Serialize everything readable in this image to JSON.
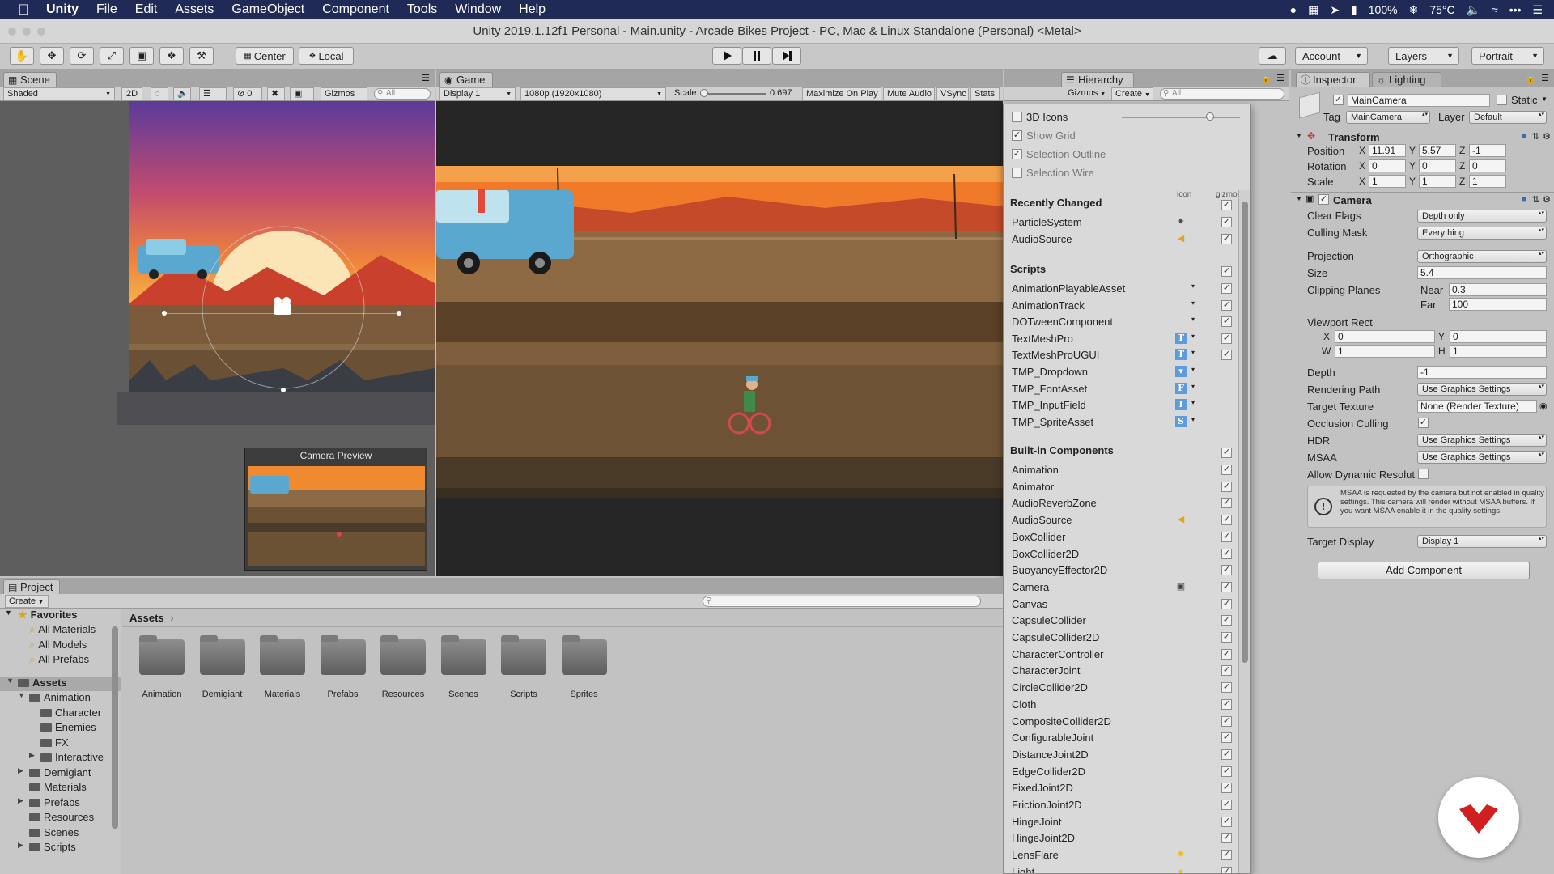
{
  "menubar": {
    "items": [
      "Unity",
      "File",
      "Edit",
      "Assets",
      "GameObject",
      "Component",
      "Tools",
      "Window",
      "Help"
    ],
    "battery": "100%",
    "temperature": "75°C"
  },
  "window": {
    "title": "Unity 2019.1.12f1 Personal - Main.unity - Arcade Bikes Project - PC, Mac & Linux Standalone (Personal) <Metal>"
  },
  "toolbar": {
    "pivot": "Center",
    "space": "Local",
    "account": "Account",
    "layers": "Layers",
    "layout": "Portrait"
  },
  "scene": {
    "tab": "Scene",
    "shading": "Shaded",
    "mode2d": "2D",
    "fx_count": "0",
    "gizmos": "Gizmos",
    "search_placeholder": "All",
    "camera_preview": "Camera Preview"
  },
  "game": {
    "tab": "Game",
    "display": "Display 1",
    "resolution": "1080p (1920x1080)",
    "scale_label": "Scale",
    "scale_value": "0.697",
    "maximize": "Maximize On Play",
    "mute": "Mute Audio",
    "vsync": "VSync",
    "stats": "Stats",
    "gizmos": "Gizmos"
  },
  "hierarchy": {
    "tab": "Hierarchy",
    "create": "Create",
    "search_placeholder": "All"
  },
  "gizmo_menu": {
    "options": [
      "3D Icons",
      "Show Grid",
      "Selection Outline",
      "Selection Wire"
    ],
    "col_icon": "icon",
    "col_gizmo": "gizmo",
    "recent_header": "Recently Changed",
    "recent": [
      "ParticleSystem",
      "AudioSource"
    ],
    "scripts_header": "Scripts",
    "scripts": [
      "AnimationPlayableAsset",
      "AnimationTrack",
      "DOTweenComponent",
      "TextMeshPro",
      "TextMeshProUGUI",
      "TMP_Dropdown",
      "TMP_FontAsset",
      "TMP_InputField",
      "TMP_SpriteAsset"
    ],
    "script_icons": [
      "",
      "",
      "",
      "T",
      "T",
      "▾",
      "F",
      "I",
      "S"
    ],
    "builtin_header": "Built-in Components",
    "builtin": [
      "Animation",
      "Animator",
      "AudioReverbZone",
      "AudioSource",
      "BoxCollider",
      "BoxCollider2D",
      "BuoyancyEffector2D",
      "Camera",
      "Canvas",
      "CapsuleCollider",
      "CapsuleCollider2D",
      "CharacterController",
      "CharacterJoint",
      "CircleCollider2D",
      "Cloth",
      "CompositeCollider2D",
      "ConfigurableJoint",
      "DistanceJoint2D",
      "EdgeCollider2D",
      "FixedJoint2D",
      "FrictionJoint2D",
      "HingeJoint",
      "HingeJoint2D",
      "LensFlare",
      "Light"
    ]
  },
  "inspector": {
    "tab": "Inspector",
    "tab2": "Lighting",
    "object_name": "MainCamera",
    "static_label": "Static",
    "tag_label": "Tag",
    "tag": "MainCamera",
    "layer_label": "Layer",
    "layer": "Default",
    "transform": {
      "header": "Transform",
      "position_label": "Position",
      "rotation_label": "Rotation",
      "scale_label": "Scale",
      "position": [
        "11.91",
        "5.57",
        "-1"
      ],
      "rotation": [
        "0",
        "0",
        "0"
      ],
      "scale": [
        "1",
        "1",
        "1"
      ]
    },
    "camera": {
      "header": "Camera",
      "clear_flags_label": "Clear Flags",
      "clear_flags": "Depth only",
      "culling_mask_label": "Culling Mask",
      "culling_mask": "Everything",
      "projection_label": "Projection",
      "projection": "Orthographic",
      "size_label": "Size",
      "size": "5.4",
      "clipping_label": "Clipping Planes",
      "near_label": "Near",
      "near": "0.3",
      "far_label": "Far",
      "far": "100",
      "viewport_label": "Viewport Rect",
      "vx": "0",
      "vy": "0",
      "vw": "1",
      "vh": "1",
      "depth_label": "Depth",
      "depth": "-1",
      "rendering_label": "Rendering Path",
      "rendering": "Use Graphics Settings",
      "target_texture_label": "Target Texture",
      "target_texture": "None (Render Texture)",
      "occlusion_label": "Occlusion Culling",
      "hdr_label": "HDR",
      "hdr": "Use Graphics Settings",
      "msaa_label": "MSAA",
      "msaa": "Use Graphics Settings",
      "dynres_label": "Allow Dynamic Resolut",
      "warning": "MSAA is requested by the camera but not enabled in quality settings. This camera will render without MSAA buffers. If you want MSAA enable it in the quality settings.",
      "target_display_label": "Target Display",
      "target_display": "Display 1"
    },
    "add_component": "Add Component"
  },
  "project": {
    "tab": "Project",
    "create": "Create",
    "favorites": "Favorites",
    "favorite_items": [
      "All Materials",
      "All Models",
      "All Prefabs"
    ],
    "assets_root": "Assets",
    "tree": [
      "Animation",
      "Character",
      "Enemies",
      "FX",
      "Interactive",
      "Demigiant",
      "Materials",
      "Prefabs",
      "Resources",
      "Scenes",
      "Scripts"
    ],
    "breadcrumb": "Assets",
    "folders": [
      "Animation",
      "Demigiant",
      "Materials",
      "Prefabs",
      "Resources",
      "Scenes",
      "Scripts",
      "Sprites"
    ]
  },
  "colors": {
    "menubar": "#1f2a57",
    "sky_top": "#f07a2a",
    "ground": "#6e5638",
    "icon_blue": "#5b9be0",
    "logo_red": "#d11f1f"
  }
}
